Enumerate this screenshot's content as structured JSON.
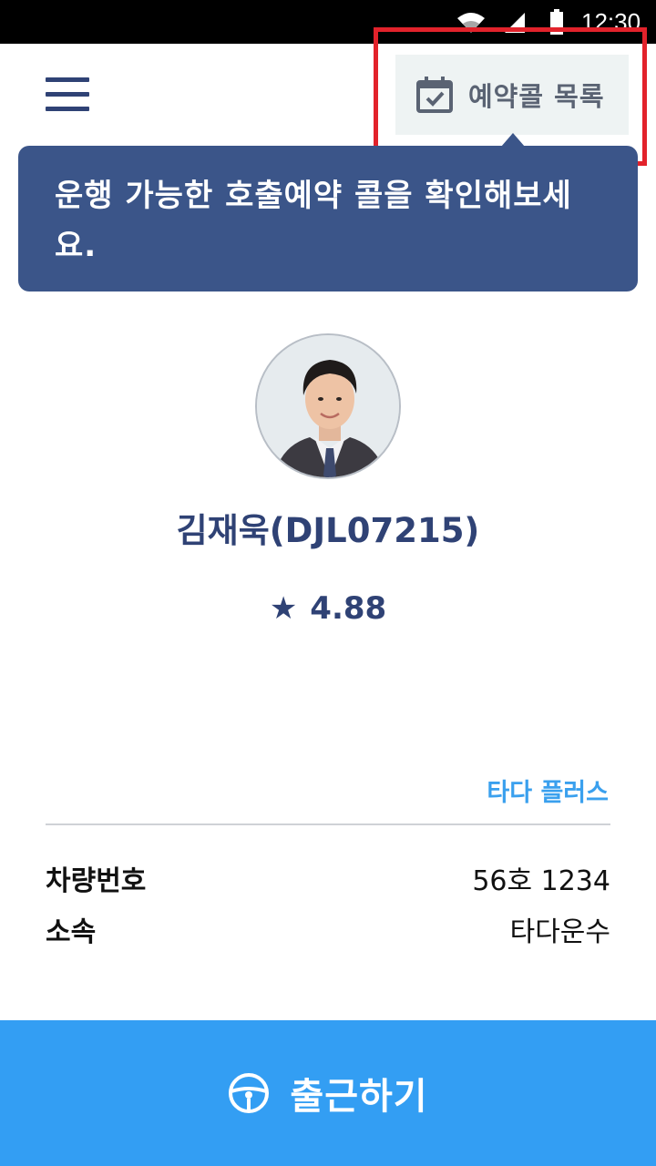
{
  "status_bar": {
    "time": "12:30",
    "icons": [
      "wifi-icon",
      "signal-icon",
      "battery-icon"
    ]
  },
  "header": {
    "menu_icon": "hamburger-menu-icon",
    "reservation_button": {
      "label": "예약콜 목록",
      "icon": "calendar-check-icon"
    }
  },
  "tooltip": {
    "text": "운행 가능한 호출예약 콜을 확인해보세요."
  },
  "driver": {
    "name": "김재욱(DJL07215)",
    "rating": "4.88",
    "rating_icon": "star-icon"
  },
  "vehicle": {
    "service": "타다 플러스",
    "rows": [
      {
        "label": "차량번호",
        "value": "56호 1234"
      },
      {
        "label": "소속",
        "value": "타다운수"
      }
    ]
  },
  "footer": {
    "start_button_label": "출근하기",
    "icon": "steering-wheel-icon"
  },
  "colors": {
    "primary_navy": "#2f4275",
    "tooltip_bg": "#3b5589",
    "accent_blue": "#339ef3",
    "service_blue": "#3aa0ee",
    "highlight_red": "#e2222b",
    "reserve_button_bg": "#eef3f3"
  }
}
